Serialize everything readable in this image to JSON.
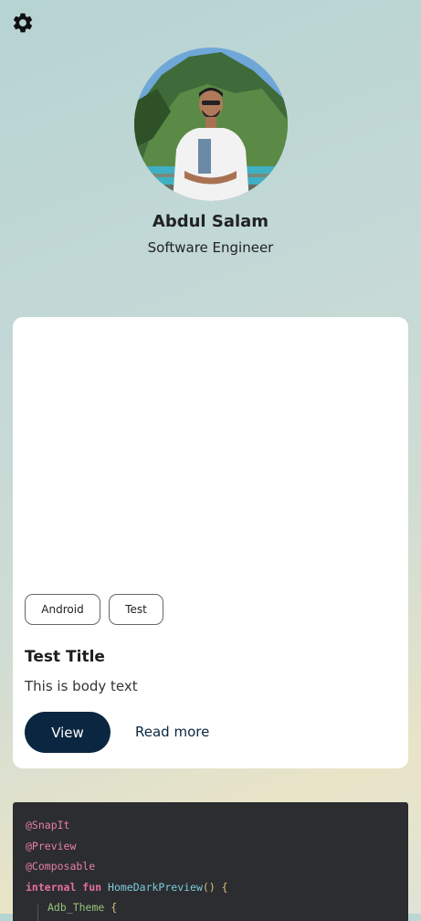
{
  "header": {
    "settings_icon": "gear-icon"
  },
  "profile": {
    "name": "Abdul Salam",
    "role": "Software Engineer"
  },
  "card": {
    "chips": [
      "Android",
      "Test"
    ],
    "title": "Test Title",
    "body": "This is body text",
    "primary_button": "View",
    "secondary_button": "Read more"
  },
  "code_snippet": {
    "line1": "@SnapIt",
    "line2": "@Preview",
    "line3": "@Composable",
    "line4_kw": "internal fun",
    "line4_fn": "HomeDarkPreview",
    "line4_paren": "() {",
    "line5_ty": "Adb_Theme",
    "line5_brace": "{"
  },
  "colors": {
    "primary": "#0b2640",
    "card_bg": "#ffffff",
    "code_bg": "#2b2d31"
  }
}
